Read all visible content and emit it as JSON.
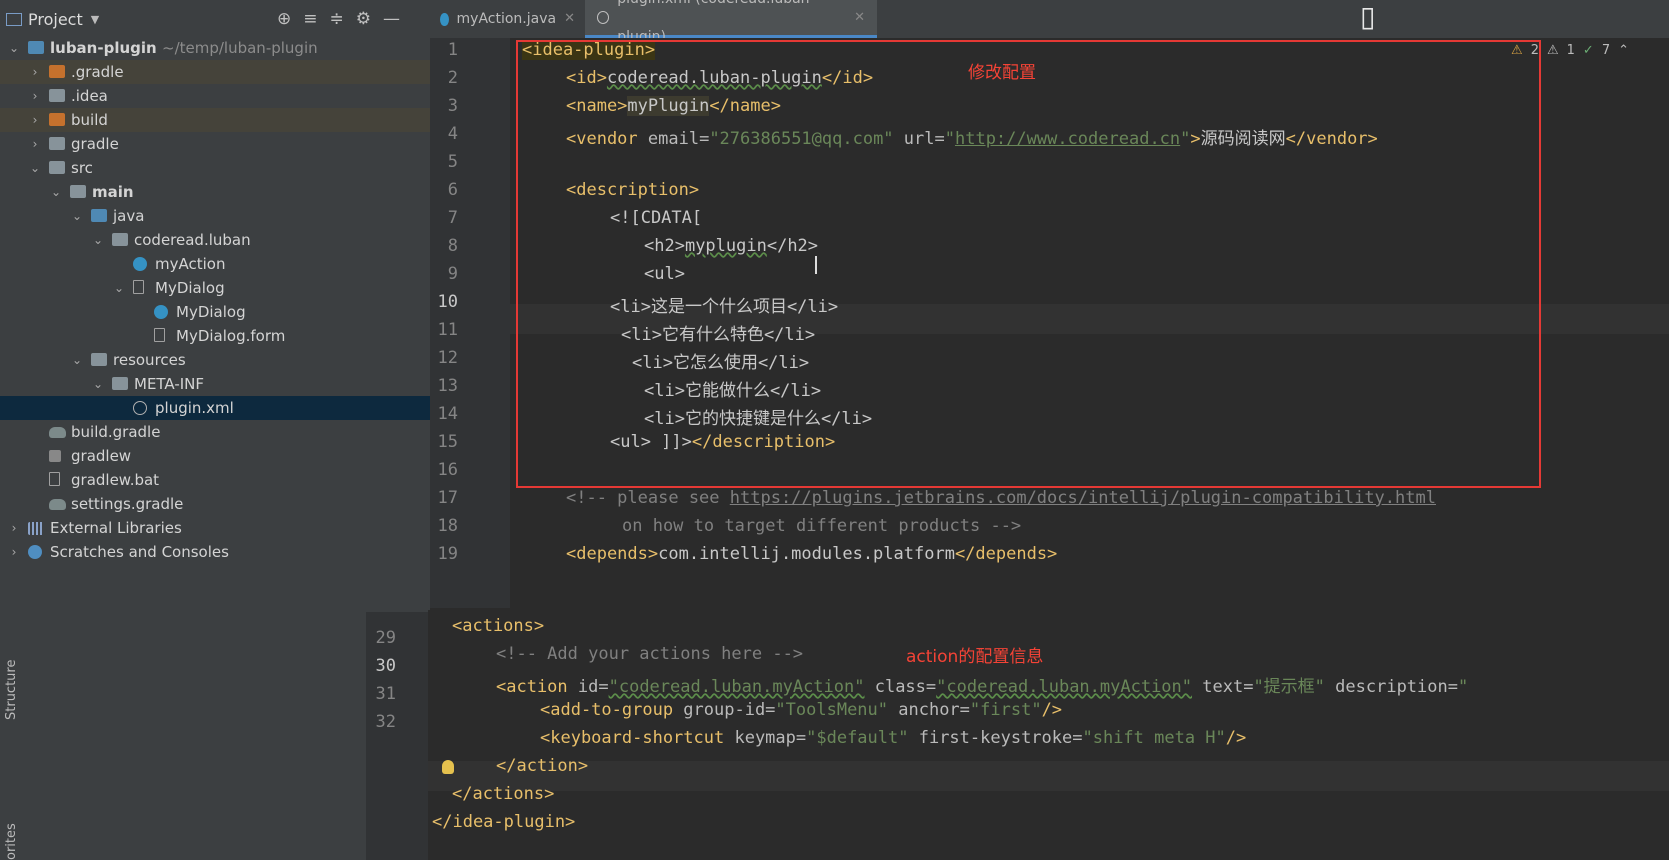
{
  "project_panel": {
    "title": "Project",
    "tree": [
      {
        "label": "luban-plugin",
        "suffix": "~/temp/luban-plugin",
        "depth": 0,
        "icon": "module-folder-icon",
        "expanded": true,
        "bold": true
      },
      {
        "label": ".gradle",
        "depth": 1,
        "icon": "folder-excluded-icon",
        "expanded": false
      },
      {
        "label": ".idea",
        "depth": 1,
        "icon": "folder-icon",
        "expanded": false
      },
      {
        "label": "build",
        "depth": 1,
        "icon": "folder-excluded-icon",
        "expanded": false
      },
      {
        "label": "gradle",
        "depth": 1,
        "icon": "folder-icon",
        "expanded": false
      },
      {
        "label": "src",
        "depth": 1,
        "icon": "folder-icon",
        "expanded": true
      },
      {
        "label": "main",
        "depth": 2,
        "icon": "folder-icon",
        "expanded": true,
        "bold": true
      },
      {
        "label": "java",
        "depth": 3,
        "icon": "source-folder-icon",
        "expanded": true
      },
      {
        "label": "coderead.luban",
        "depth": 4,
        "icon": "package-icon",
        "expanded": true
      },
      {
        "label": "myAction",
        "depth": 5,
        "icon": "class-icon"
      },
      {
        "label": "MyDialog",
        "depth": 5,
        "icon": "form-icon",
        "expanded": true
      },
      {
        "label": "MyDialog",
        "depth": 6,
        "icon": "class-icon"
      },
      {
        "label": "MyDialog.form",
        "depth": 6,
        "icon": "file-icon"
      },
      {
        "label": "resources",
        "depth": 3,
        "icon": "resources-folder-icon",
        "expanded": true
      },
      {
        "label": "META-INF",
        "depth": 4,
        "icon": "folder-icon",
        "expanded": true
      },
      {
        "label": "plugin.xml",
        "depth": 5,
        "icon": "xml-file-icon",
        "selected": true
      },
      {
        "label": "build.gradle",
        "depth": 1,
        "icon": "gradle-icon"
      },
      {
        "label": "gradlew",
        "depth": 1,
        "icon": "terminal-file-icon"
      },
      {
        "label": "gradlew.bat",
        "depth": 1,
        "icon": "file-icon"
      },
      {
        "label": "settings.gradle",
        "depth": 1,
        "icon": "gradle-icon"
      },
      {
        "label": "External Libraries",
        "depth": 0,
        "icon": "library-icon",
        "expanded": false
      },
      {
        "label": "Scratches and Consoles",
        "depth": 0,
        "icon": "scratches-icon",
        "expanded": false
      }
    ]
  },
  "tabs": [
    {
      "label": "myAction.java",
      "active": false
    },
    {
      "label": "plugin.xml (coderead.luban-plugin)",
      "active": true
    }
  ],
  "editor": {
    "indicators": {
      "warnings": "2",
      "weak_warnings": "1",
      "typos": "7"
    },
    "annotation_top": "修改配置",
    "line_numbers": [
      "1",
      "2",
      "3",
      "4",
      "5",
      "6",
      "7",
      "8",
      "9",
      "10",
      "11",
      "12",
      "13",
      "14",
      "15",
      "16",
      "17",
      "18",
      "19"
    ],
    "current_line": "10",
    "code": {
      "l1_tag": "<idea-plugin>",
      "l2_open": "<id>",
      "l2_text": "coderead.luban-plugin",
      "l2_close": "</id>",
      "l3_open": "<name>",
      "l3_text": "myPlugin",
      "l3_close": "</name>",
      "l4_open": "<vendor",
      "l4_attr1": " email=",
      "l4_val1": "\"276386551@qq.com\"",
      "l4_attr2": " url=",
      "l4_q1": "\"",
      "l4_url": "http://www.coderead.cn",
      "l4_q2": "\"",
      "l4_gt": ">",
      "l4_text": "源码阅读网",
      "l4_close": "</vendor>",
      "l6_open": "<description>",
      "l7": "<![CDATA[",
      "l8_open": "<h2>",
      "l8_text": "myplugin",
      "l8_close": "</h2>",
      "l9": "<ul>",
      "l10": "<li>这是一个什么项目</li>",
      "l11": "<li>它有什么特色</li>",
      "l12": "<li>它怎么使用</li>",
      "l13": "<li>它能做什么</li>",
      "l14": "<li>它的快捷键是什么</li>",
      "l15_a": "<ul> ]]>",
      "l15_close": "</description>",
      "l17_a": "<!-- please see ",
      "l17_url": "https://plugins.jetbrains.com/docs/intellij/plugin-compatibility.html",
      "l18": "on how to target different products -->",
      "l19_open": "<depends>",
      "l19_text": "com.intellij.modules.platform",
      "l19_close": "</depends>"
    }
  },
  "bottom_editor": {
    "line_numbers": [
      "29",
      "30",
      "31",
      "32"
    ],
    "current_line": "30",
    "annotation": "action的配置信息",
    "code": {
      "b1": "<actions>",
      "b2": "<!-- Add your actions here -->",
      "b3_open": "<action",
      "b3_a1": " id=",
      "b3_v1": "\"coderead.luban.myAction\"",
      "b3_a2": " class=",
      "b3_v2": "\"coderead.luban.myAction\"",
      "b3_a3": " text=",
      "b3_v3": "\"提示框\"",
      "b3_a4": " description=",
      "b3_v4": "\"",
      "b4_open": "<add-to-group",
      "b4_a1": " group-id=",
      "b4_v1": "\"ToolsMenu\"",
      "b4_a2": " anchor=",
      "b4_v2": "\"first\"",
      "b4_close": "/>",
      "b5_open": "<keyboard-shortcut",
      "b5_a1": " keymap=",
      "b5_v1": "\"$default\"",
      "b5_a2": " first-keystroke=",
      "b5_v2": "\"shift meta H\"",
      "b5_close": "/>",
      "b6": "</action>",
      "b7": "</actions>",
      "b8": "</idea-plugin>"
    }
  },
  "side_tools": {
    "structure": "Structure",
    "favorites": "orites"
  }
}
